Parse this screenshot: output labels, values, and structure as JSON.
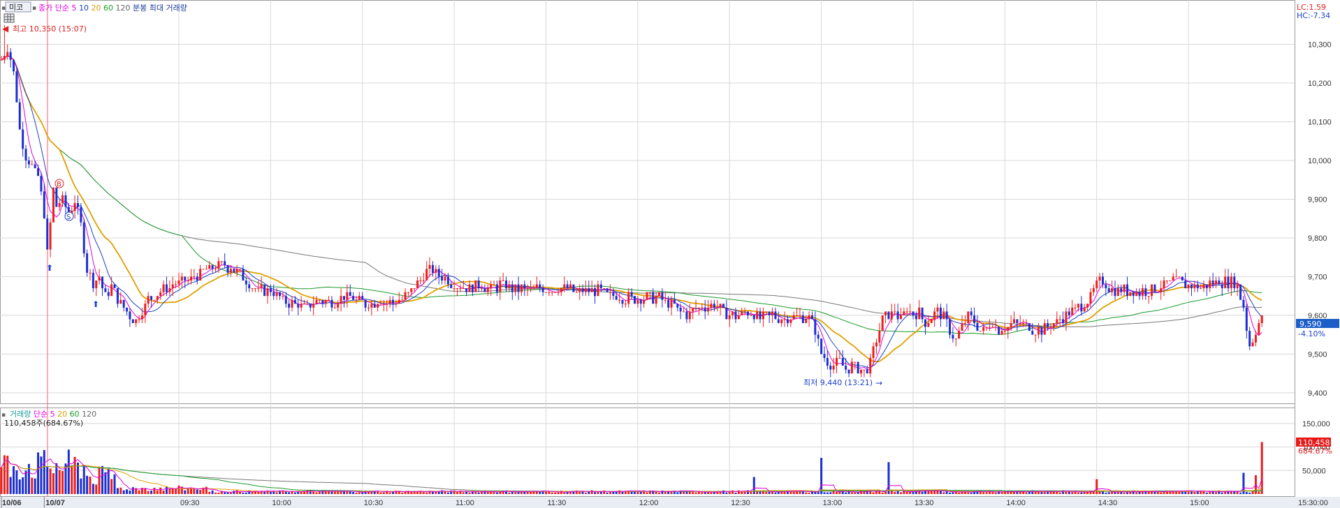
{
  "toolbar": {
    "mode_label": "미코",
    "price_legend": [
      {
        "text": "종가 단순",
        "color": "#e000e0"
      },
      {
        "text": "5",
        "color": "#e000e0"
      },
      {
        "text": "10",
        "color": "#1f3fbf"
      },
      {
        "text": "20",
        "color": "#e0a000"
      },
      {
        "text": "60",
        "color": "#1a9a2a"
      },
      {
        "text": "120",
        "color": "#666666"
      },
      {
        "text": "분봉 최대 거래량",
        "color": "#1a3a9a"
      }
    ],
    "volume_legend": [
      {
        "text": "거래량",
        "color": "#1a9a9a"
      },
      {
        "text": "단순 5",
        "color": "#e000e0"
      },
      {
        "text": "20",
        "color": "#e0a000"
      },
      {
        "text": "60",
        "color": "#1a9a2a"
      },
      {
        "text": "120",
        "color": "#666666"
      }
    ]
  },
  "corner_info": {
    "lc": "LC:1.59",
    "hc": "HC:-7.34"
  },
  "annotations": {
    "high": "최고 10,350 (15:07)",
    "low": "최저 9,440 (13:21)",
    "volume_current": "110,458주(684.67%)",
    "price_tag": "9,590",
    "price_change": "-4.10%",
    "volume_tag": "110,458",
    "volume_pct": "684.67%",
    "buy_marker": "B",
    "sell_marker": "S"
  },
  "colors": {
    "up": "#ee1c1c",
    "down": "#1c2fd0",
    "ma5": "#e000e0",
    "ma10": "#1f3fbf",
    "ma20": "#e0a000",
    "ma60": "#1a9a2a",
    "ma120": "#777777",
    "grid": "#d8d8d8",
    "tag_bg": "#1c5ec8"
  },
  "chart_data": {
    "type": "candlestick",
    "price_axis": {
      "ylim": [
        9380,
        10400
      ],
      "ticks": [
        "10,300",
        "10,200",
        "10,100",
        "10,000",
        "9,900",
        "9,800",
        "9,700",
        "9,600",
        "9,500",
        "9,400"
      ],
      "tick_values": [
        10300,
        10200,
        10100,
        10000,
        9900,
        9800,
        9700,
        9600,
        9500,
        9400
      ]
    },
    "volume_axis": {
      "ylim": [
        0,
        175000
      ],
      "ticks": [
        "150,000",
        "100,000",
        "50,000"
      ],
      "tick_values": [
        150000,
        100000,
        50000
      ]
    },
    "x_axis": {
      "range_minutes": [
        -28,
        394
      ],
      "ticks": [
        {
          "t": -28,
          "label": "10/06"
        },
        {
          "t": -14,
          "label": "10/07"
        },
        {
          "t": 30,
          "label": "09:30"
        },
        {
          "t": 60,
          "label": "10:00"
        },
        {
          "t": 90,
          "label": "10:30"
        },
        {
          "t": 120,
          "label": "11:00"
        },
        {
          "t": 150,
          "label": "11:30"
        },
        {
          "t": 180,
          "label": "12:00"
        },
        {
          "t": 210,
          "label": "12:30"
        },
        {
          "t": 240,
          "label": "13:00"
        },
        {
          "t": 270,
          "label": "13:30"
        },
        {
          "t": 300,
          "label": "14:00"
        },
        {
          "t": 330,
          "label": "14:30"
        },
        {
          "t": 360,
          "label": "15:00"
        },
        {
          "t": 390,
          "label": "15:30:00"
        }
      ]
    },
    "price_keyframes": [
      [
        -28,
        10260
      ],
      [
        -26,
        10290
      ],
      [
        -24,
        10230
      ],
      [
        -22,
        10080
      ],
      [
        -20,
        10010
      ],
      [
        -18,
        9980
      ],
      [
        -16,
        9960
      ],
      [
        -14,
        9860
      ],
      [
        -13,
        9760
      ],
      [
        -12,
        9840
      ],
      [
        -11,
        9930
      ],
      [
        -10,
        9880
      ],
      [
        -8,
        9900
      ],
      [
        -6,
        9860
      ],
      [
        -4,
        9900
      ],
      [
        -2,
        9830
      ],
      [
        0,
        9720
      ],
      [
        2,
        9680
      ],
      [
        4,
        9700
      ],
      [
        6,
        9650
      ],
      [
        8,
        9680
      ],
      [
        10,
        9640
      ],
      [
        12,
        9620
      ],
      [
        14,
        9600
      ],
      [
        16,
        9590
      ],
      [
        18,
        9610
      ],
      [
        20,
        9640
      ],
      [
        24,
        9660
      ],
      [
        28,
        9680
      ],
      [
        32,
        9690
      ],
      [
        36,
        9700
      ],
      [
        40,
        9720
      ],
      [
        44,
        9730
      ],
      [
        48,
        9720
      ],
      [
        52,
        9690
      ],
      [
        56,
        9660
      ],
      [
        60,
        9670
      ],
      [
        64,
        9640
      ],
      [
        68,
        9630
      ],
      [
        72,
        9620
      ],
      [
        76,
        9640
      ],
      [
        80,
        9630
      ],
      [
        84,
        9650
      ],
      [
        88,
        9640
      ],
      [
        92,
        9630
      ],
      [
        96,
        9640
      ],
      [
        100,
        9630
      ],
      [
        104,
        9650
      ],
      [
        108,
        9680
      ],
      [
        112,
        9720
      ],
      [
        116,
        9700
      ],
      [
        120,
        9680
      ],
      [
        124,
        9670
      ],
      [
        128,
        9680
      ],
      [
        132,
        9670
      ],
      [
        136,
        9680
      ],
      [
        140,
        9670
      ],
      [
        144,
        9665
      ],
      [
        148,
        9670
      ],
      [
        152,
        9665
      ],
      [
        156,
        9670
      ],
      [
        160,
        9660
      ],
      [
        164,
        9665
      ],
      [
        168,
        9660
      ],
      [
        172,
        9650
      ],
      [
        176,
        9645
      ],
      [
        180,
        9640
      ],
      [
        184,
        9650
      ],
      [
        188,
        9640
      ],
      [
        192,
        9620
      ],
      [
        196,
        9600
      ],
      [
        200,
        9620
      ],
      [
        204,
        9630
      ],
      [
        208,
        9610
      ],
      [
        212,
        9600
      ],
      [
        216,
        9610
      ],
      [
        220,
        9590
      ],
      [
        224,
        9600
      ],
      [
        228,
        9590
      ],
      [
        232,
        9600
      ],
      [
        236,
        9590
      ],
      [
        238,
        9560
      ],
      [
        240,
        9500
      ],
      [
        242,
        9480
      ],
      [
        244,
        9470
      ],
      [
        246,
        9480
      ],
      [
        248,
        9465
      ],
      [
        250,
        9470
      ],
      [
        252,
        9460
      ],
      [
        254,
        9455
      ],
      [
        256,
        9480
      ],
      [
        258,
        9540
      ],
      [
        260,
        9590
      ],
      [
        262,
        9600
      ],
      [
        264,
        9610
      ],
      [
        266,
        9590
      ],
      [
        268,
        9620
      ],
      [
        270,
        9600
      ],
      [
        272,
        9610
      ],
      [
        274,
        9580
      ],
      [
        276,
        9600
      ],
      [
        278,
        9610
      ],
      [
        280,
        9600
      ],
      [
        282,
        9560
      ],
      [
        284,
        9540
      ],
      [
        286,
        9570
      ],
      [
        288,
        9600
      ],
      [
        290,
        9580
      ],
      [
        292,
        9560
      ],
      [
        294,
        9570
      ],
      [
        296,
        9580
      ],
      [
        298,
        9560
      ],
      [
        300,
        9570
      ],
      [
        304,
        9580
      ],
      [
        308,
        9570
      ],
      [
        312,
        9560
      ],
      [
        316,
        9580
      ],
      [
        320,
        9600
      ],
      [
        324,
        9620
      ],
      [
        328,
        9650
      ],
      [
        330,
        9680
      ],
      [
        332,
        9690
      ],
      [
        334,
        9670
      ],
      [
        336,
        9660
      ],
      [
        340,
        9665
      ],
      [
        344,
        9660
      ],
      [
        348,
        9670
      ],
      [
        352,
        9680
      ],
      [
        356,
        9690
      ],
      [
        360,
        9680
      ],
      [
        364,
        9675
      ],
      [
        368,
        9685
      ],
      [
        372,
        9690
      ],
      [
        376,
        9680
      ],
      [
        378,
        9620
      ],
      [
        380,
        9520
      ],
      [
        382,
        9560
      ],
      [
        384,
        9590
      ]
    ],
    "marked_extremes": {
      "high": 10350,
      "low": 9440
    },
    "volume_last": 110458
  }
}
